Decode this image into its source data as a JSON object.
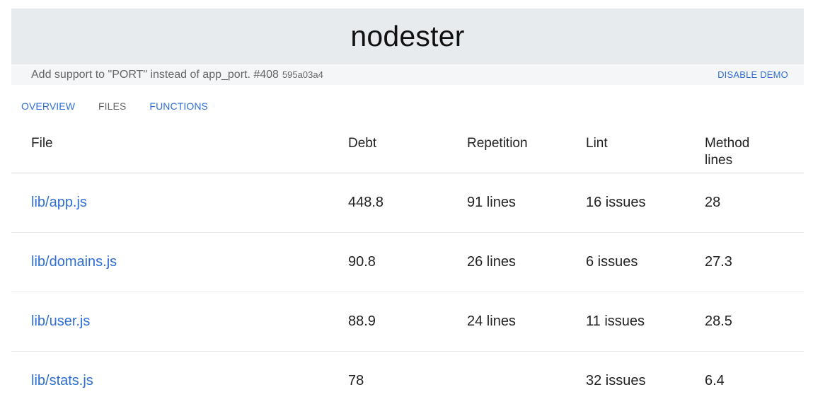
{
  "header": {
    "title": "nodester"
  },
  "commit": {
    "message": "Add support to \"PORT\" instead of app_port. #408",
    "hash": "595a03a4",
    "disable_demo_label": "DISABLE DEMO"
  },
  "tabs": [
    {
      "label": "OVERVIEW",
      "active": false
    },
    {
      "label": "FILES",
      "active": true
    },
    {
      "label": "FUNCTIONS",
      "active": false
    }
  ],
  "table": {
    "columns": [
      "File",
      "Debt",
      "Repetition",
      "Lint",
      "Method lines"
    ],
    "rows": [
      {
        "file": "lib/app.js",
        "debt": "448.8",
        "repetition": "91 lines",
        "lint": "16 issues",
        "method_lines": "28"
      },
      {
        "file": "lib/domains.js",
        "debt": "90.8",
        "repetition": "26 lines",
        "lint": "6 issues",
        "method_lines": "27.3"
      },
      {
        "file": "lib/user.js",
        "debt": "88.9",
        "repetition": "24 lines",
        "lint": "11 issues",
        "method_lines": "28.5"
      },
      {
        "file": "lib/stats.js",
        "debt": "78",
        "repetition": "",
        "lint": "32 issues",
        "method_lines": "6.4"
      }
    ]
  },
  "colors": {
    "link": "#2e6fd6",
    "header_bg": "#e8ebee",
    "commit_bg": "#f5f6f7"
  }
}
